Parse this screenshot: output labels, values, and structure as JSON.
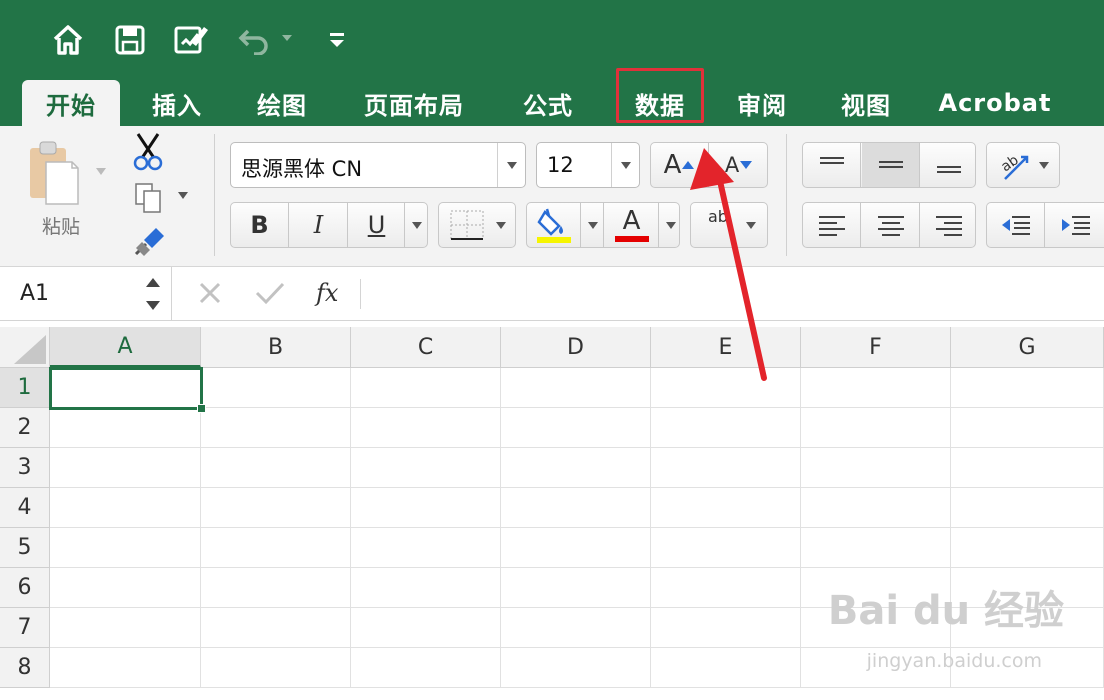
{
  "tabs": [
    {
      "label": "开始",
      "active": true
    },
    {
      "label": "插入"
    },
    {
      "label": "绘图"
    },
    {
      "label": "页面布局"
    },
    {
      "label": "公式"
    },
    {
      "label": "数据",
      "highlighted": true
    },
    {
      "label": "审阅"
    },
    {
      "label": "视图"
    },
    {
      "label": "Acrobat"
    }
  ],
  "quick_access": [
    "home-icon",
    "save-icon",
    "edit-icon",
    "undo-icon",
    "customize-icon"
  ],
  "ribbon": {
    "paste_label": "粘贴",
    "font_name": "思源黑体 CN",
    "font_size": "12",
    "bold": "B",
    "italic": "I",
    "underline": "U",
    "font_color_letter": "A",
    "grow_letter": "A",
    "shrink_letter": "A",
    "phonetic_letters": "ab"
  },
  "formula_bar": {
    "name_box": "A1",
    "fx": "fx",
    "formula": ""
  },
  "grid": {
    "columns": [
      "A",
      "B",
      "C",
      "D",
      "E",
      "F",
      "G"
    ],
    "rows": [
      "1",
      "2",
      "3",
      "4",
      "5",
      "6",
      "7",
      "8"
    ],
    "selected_cell": "A1"
  },
  "colors": {
    "title_bar": "#227447",
    "highlight_box": "#e0313a",
    "fill_color": "#f6f500",
    "font_color": "#e40000",
    "arrow": "#e3242b"
  },
  "watermark": {
    "brand": "Bai du 经验",
    "url": "jingyan.baidu.com"
  }
}
